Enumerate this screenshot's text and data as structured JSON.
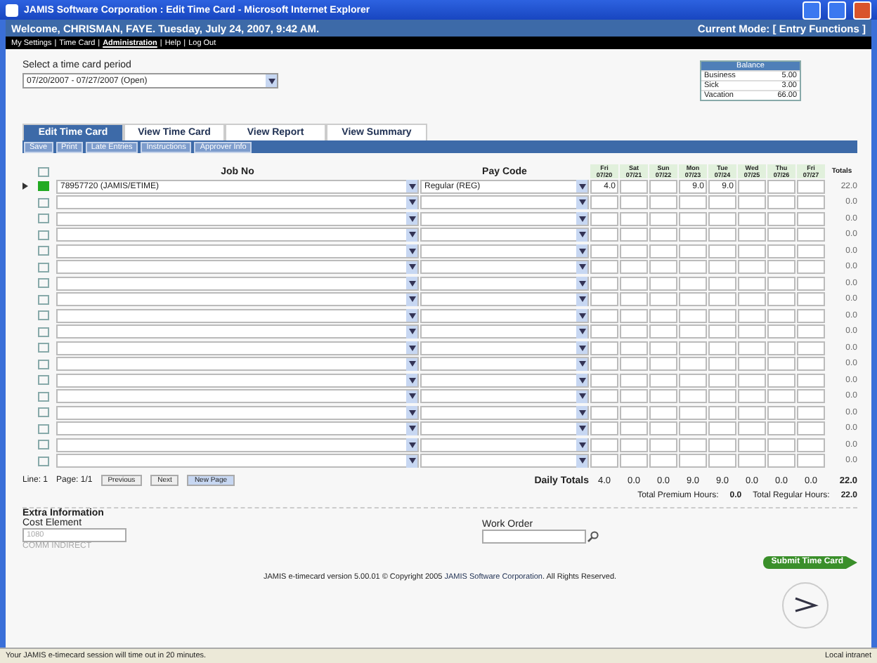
{
  "window": {
    "title": "JAMIS Software Corporation : Edit Time Card - Microsoft Internet Explorer"
  },
  "welcome": "Welcome, CHRISMAN, FAYE. Tuesday, July 24, 2007, 9:42 AM.",
  "mode": "Current Mode: [ Entry Functions ]",
  "menu_separator": "|",
  "menu": [
    {
      "label": "My Settings",
      "selected": false
    },
    {
      "label": "Time Card",
      "selected": false
    },
    {
      "label": "Administration",
      "selected": true
    },
    {
      "label": "Help",
      "selected": false
    },
    {
      "label": "Log Out",
      "selected": false
    }
  ],
  "period": {
    "label": "Select a time card period",
    "value": "07/20/2007 - 07/27/2007 (Open)"
  },
  "balance": {
    "title": "Balance",
    "rows": [
      {
        "name": "Business",
        "value": "5.00"
      },
      {
        "name": "Sick",
        "value": "3.00"
      },
      {
        "name": "Vacation",
        "value": "66.00"
      }
    ]
  },
  "tabs": [
    {
      "label": "Edit Time Card",
      "selected": true
    },
    {
      "label": "View Time Card",
      "selected": false
    },
    {
      "label": "View Report",
      "selected": false
    },
    {
      "label": "View Summary",
      "selected": false
    }
  ],
  "toolbar": [
    "Save",
    "Print",
    "Late Entries",
    "Instructions",
    "Approver Info"
  ],
  "table": {
    "columns": {
      "job": "Job No",
      "pay": "Pay Code",
      "totals": "Totals"
    },
    "days": [
      {
        "day": "Fri",
        "date": "07/20"
      },
      {
        "day": "Sat",
        "date": "07/21"
      },
      {
        "day": "Sun",
        "date": "07/22"
      },
      {
        "day": "Mon",
        "date": "07/23"
      },
      {
        "day": "Tue",
        "date": "07/24"
      },
      {
        "day": "Wed",
        "date": "07/25"
      },
      {
        "day": "Thu",
        "date": "07/26"
      },
      {
        "day": "Fri",
        "date": "07/27"
      }
    ],
    "rows": [
      {
        "current": true,
        "color": "#22aa22",
        "job": "78957720 (JAMIS/ETIME)",
        "pay_code": "Regular (REG)",
        "hours": {
          "07/20": "4.0",
          "07/23": "9.0",
          "07/24": "9.0"
        },
        "total": "22.0"
      },
      {
        "current": false,
        "total": "0.0"
      },
      {
        "current": false,
        "total": "0.0"
      },
      {
        "current": false,
        "total": "0.0"
      },
      {
        "current": false,
        "total": "0.0"
      },
      {
        "current": false,
        "total": "0.0"
      },
      {
        "current": false,
        "total": "0.0"
      },
      {
        "current": false,
        "total": "0.0"
      },
      {
        "current": false,
        "total": "0.0"
      },
      {
        "current": false,
        "total": "0.0"
      },
      {
        "current": false,
        "total": "0.0"
      },
      {
        "current": false,
        "total": "0.0"
      },
      {
        "current": false,
        "total": "0.0"
      },
      {
        "current": false,
        "total": "0.0"
      },
      {
        "current": false,
        "total": "0.0"
      },
      {
        "current": false,
        "total": "0.0"
      },
      {
        "current": false,
        "total": "0.0"
      },
      {
        "current": false,
        "total": "0.0"
      }
    ]
  },
  "pager": {
    "line": "Line: 1",
    "page": "Page: 1/1",
    "buttons": [
      "Previous",
      "Next",
      "New Page"
    ]
  },
  "daily_totals": {
    "label": "Daily Totals",
    "values": [
      "4.0",
      "0.0",
      "0.0",
      "9.0",
      "9.0",
      "0.0",
      "0.0",
      "0.0"
    ],
    "total": "22.0"
  },
  "summary": [
    {
      "label": "Total Premium Hours:",
      "value": "0.0"
    },
    {
      "label": "Total Regular Hours:",
      "value": "22.0"
    }
  ],
  "extra": {
    "title": "Extra Information",
    "cost_label": "Cost Element",
    "cost_value": "1080",
    "cost_desc": "COMM INDIRECT",
    "work_label": "Work Order"
  },
  "submit": "Submit Time Card",
  "copyright": {
    "before": "JAMIS e-timecard version 5.00.01 © Copyright 2005 ",
    "link": "JAMIS Software Corporation",
    "after": ". All Rights Reserved."
  },
  "status_bar": {
    "message": "Your JAMIS e-timecard session will time out in 20 minutes.",
    "zone": "Local intranet"
  }
}
